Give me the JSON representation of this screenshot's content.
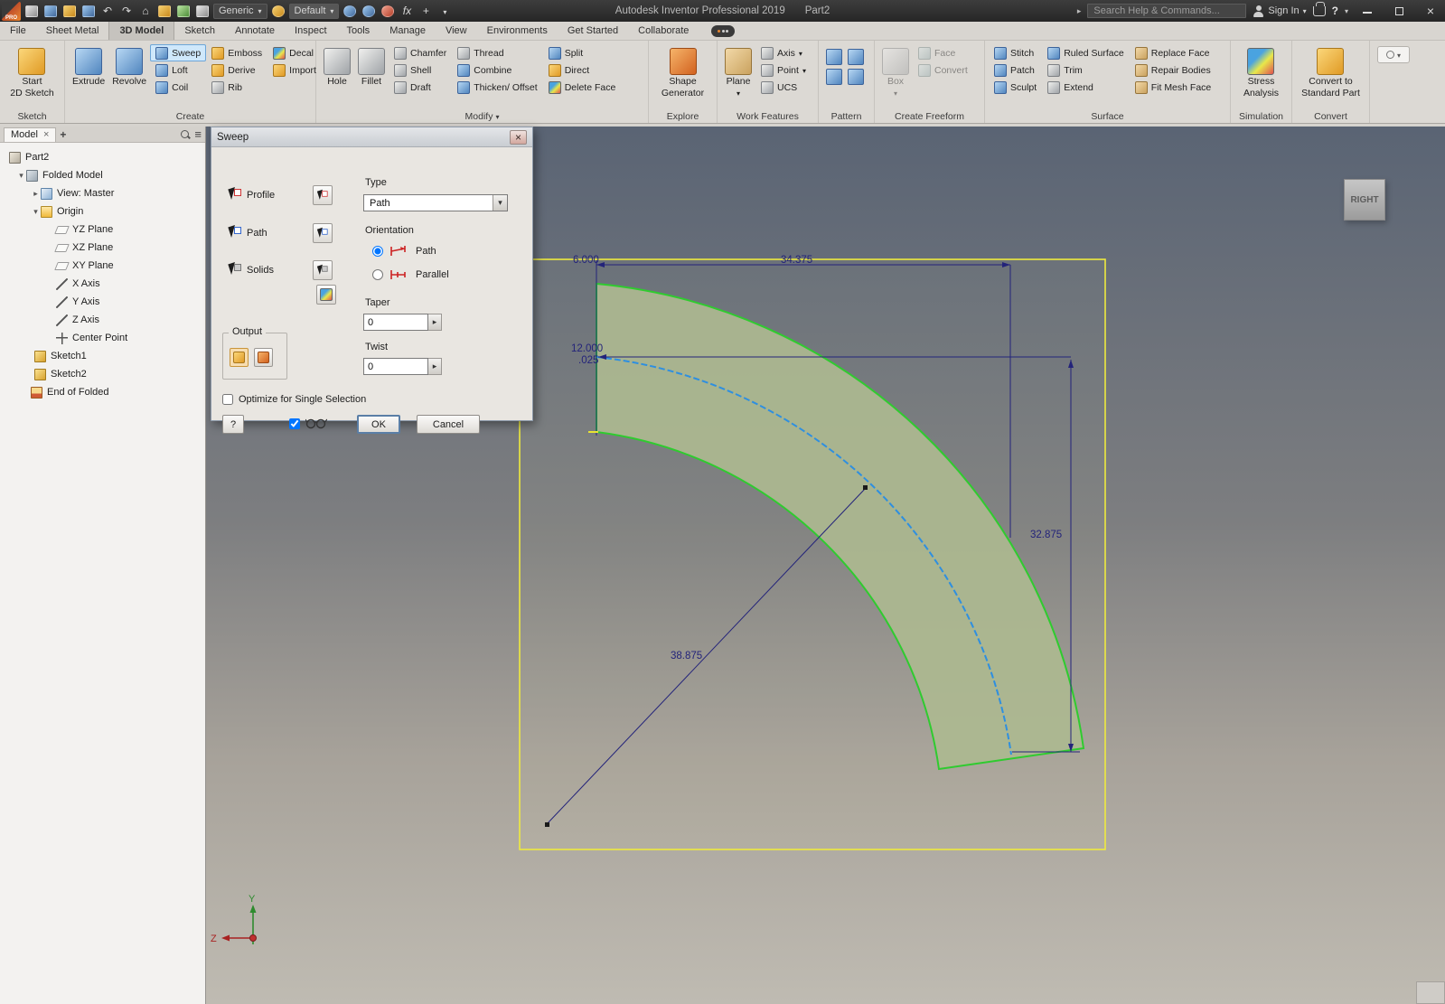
{
  "colors": {
    "accent": "#cfe8fb",
    "accent_border": "#6da6d8",
    "geometry_green": "#2fcb2f",
    "geometry_fill": "#acb890",
    "plane_yellow": "#eeea3e",
    "path_blue": "#2e8fe0",
    "dim_navy": "#23237a",
    "viewport_top": "#5a6474",
    "viewport_bottom": "#bfbbb2"
  },
  "titlebar": {
    "app_title": "Autodesk Inventor Professional 2019",
    "doc_title": "Part2",
    "material": "Generic",
    "appearance": "Default",
    "fx": "fx",
    "search_placeholder": "Search Help & Commands...",
    "sign_in_label": "Sign In"
  },
  "tabs": {
    "items": [
      "File",
      "Sheet Metal",
      "3D Model",
      "Sketch",
      "Annotate",
      "Inspect",
      "Tools",
      "Manage",
      "View",
      "Environments",
      "Get Started",
      "Collaborate"
    ]
  },
  "ribbon": {
    "sketch": {
      "label": "Sketch",
      "b1a": "Start",
      "b1b": "2D Sketch"
    },
    "create": {
      "label": "Create",
      "big1": "Extrude",
      "big2": "Revolve",
      "col1": [
        "Sweep",
        "Loft",
        "Coil"
      ],
      "col2": [
        "Emboss",
        "Derive",
        "Rib"
      ],
      "col3": [
        "Decal",
        "Import"
      ]
    },
    "modify": {
      "label": "Modify",
      "big1": "Hole",
      "big2": "Fillet",
      "col1": [
        "Chamfer",
        "Shell",
        "Draft"
      ],
      "col2": [
        "Thread",
        "Combine",
        "Thicken/ Offset"
      ],
      "col3": [
        "Split",
        "Direct",
        "Delete Face"
      ]
    },
    "explore": {
      "label": "Explore",
      "b1a": "Shape",
      "b1b": "Generator"
    },
    "work": {
      "label": "Work Features",
      "big1": "Plane",
      "col1": [
        "Axis",
        "Point",
        "UCS"
      ]
    },
    "pattern": {
      "label": "Pattern"
    },
    "freeform": {
      "label": "Create Freeform",
      "big1": "Box",
      "col1": [
        "Face",
        "Convert"
      ]
    },
    "surface": {
      "label": "Surface",
      "col1": [
        "Stitch",
        "Patch",
        "Sculpt"
      ],
      "col2": [
        "Ruled Surface",
        "Trim",
        "Extend"
      ],
      "col3": [
        "Replace Face",
        "Repair Bodies",
        "Fit Mesh Face"
      ]
    },
    "simulation": {
      "label": "Simulation",
      "b1a": "Stress",
      "b1b": "Analysis"
    },
    "convert": {
      "label": "Convert",
      "b1a": "Convert to",
      "b1b": "Standard Part"
    }
  },
  "browser": {
    "tab": "Model",
    "tree": [
      {
        "label": "Part2"
      },
      {
        "label": "Folded Model"
      },
      {
        "label": "View: Master"
      },
      {
        "label": "Origin"
      },
      {
        "label": "YZ Plane"
      },
      {
        "label": "XZ Plane"
      },
      {
        "label": "XY Plane"
      },
      {
        "label": "X Axis"
      },
      {
        "label": "Y Axis"
      },
      {
        "label": "Z Axis"
      },
      {
        "label": "Center Point"
      },
      {
        "label": "Sketch1"
      },
      {
        "label": "Sketch2"
      },
      {
        "label": "End of Folded"
      }
    ]
  },
  "dialog": {
    "title": "Sweep",
    "profile_label": "Profile",
    "path_label": "Path",
    "solids_label": "Solids",
    "type_label": "Type",
    "type_value": "Path",
    "orientation_label": "Orientation",
    "orient_path": "Path",
    "orient_parallel": "Parallel",
    "taper_label": "Taper",
    "taper_value": "0",
    "twist_label": "Twist",
    "twist_value": "0",
    "output_label": "Output",
    "optimize_label": "Optimize for Single Selection",
    "help_label": "?",
    "ok_label": "OK",
    "cancel_label": "Cancel"
  },
  "viewport": {
    "viewcube_face": "RIGHT",
    "axis_y": "Y",
    "axis_z": "Z",
    "dims": {
      "profile_width": "6.000",
      "top_span": "34.375",
      "offset": "12.000",
      "offset2": ".025",
      "right_span": "32.875",
      "radius": "38.875"
    }
  }
}
